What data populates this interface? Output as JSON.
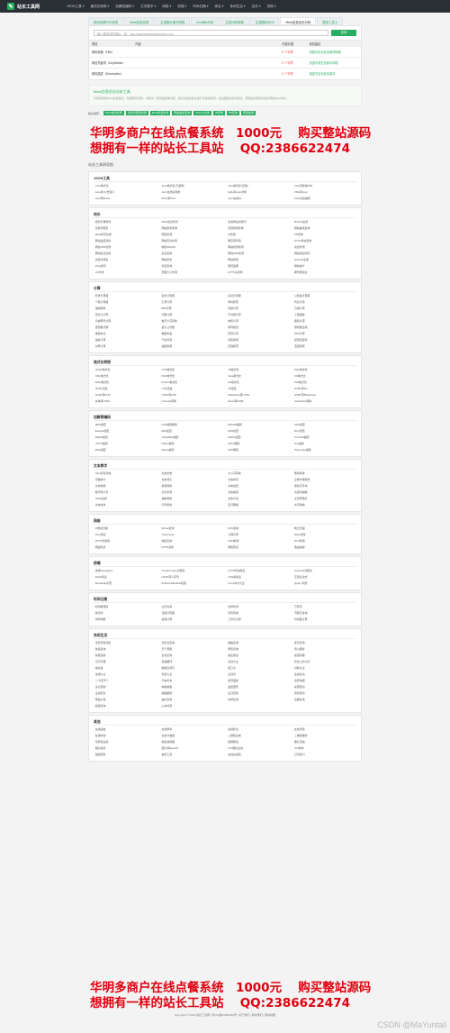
{
  "header": {
    "site_name": "站长工具网",
    "nav": [
      "JSON工具 ▾",
      "格式化转换 ▾",
      "加解密编码 ▾",
      "文本数字 ▾",
      "网络 ▾",
      "前端 ▾",
      "时间日期 ▾",
      "综合 ▾",
      "休闲生活 ▾",
      "站长 ▾",
      "其他 ▾"
    ]
  },
  "tabs": [
    "网页标题TDK检测",
    "Meta信息检测",
    "生成图片格式转换",
    "html转js代码",
    "生成代码转换",
    "生成随机MD5",
    "Meta信息优化分析",
    "更多工具 ▾"
  ],
  "query": {
    "placeholder": "输入要查询的网址，如：http://www.shimengzhanbao.com",
    "button": "查询"
  },
  "tdk_table": {
    "headers": [
      "项目",
      "内容",
      "内容长度",
      "优化建议"
    ],
    "rows": [
      {
        "item": "网页标题（Title）",
        "content": "",
        "length": "0 个字符",
        "advice": "标题中应包含关键词标题"
      },
      {
        "item": "网页关键词（KeyWords）",
        "content": "",
        "length": "0 个字符",
        "advice": "关键字需在页面中体现"
      },
      {
        "item": "网页描述（Description）",
        "content": "",
        "length": "0 个字符",
        "advice": "描述中应包含关键词"
      }
    ]
  },
  "meta_section": {
    "title": "Meta信息优化分析工具",
    "desc": "分析网页的Meta标签信息，包括网页标题、关键词、网页描述等内容，通过对这些信息进行长度的检测，给出相应的优化建议，帮助站长更好的进行网站SEO优化。"
  },
  "quick_tools": {
    "label": "相关推荐：",
    "items": [
      "Meta信息检测",
      "关键词密度检测",
      "Meta标签生成",
      "网站备案查询",
      "Robots生成",
      "IP查询",
      "PR查询",
      "死链检测"
    ]
  },
  "promo": {
    "line1": "华明多商户在线点餐系统　1000元　 购买整站源码",
    "line2": "想拥有一样的站长工具站　 QQ:2386622474"
  },
  "breadcrumb": "站长工具网导航",
  "categories": [
    {
      "name": "JSON工具",
      "items": [
        "Json格式化",
        "Json格式化(不兼容)",
        "Json格式化(压缩)",
        "Json转换成XML",
        "Json转义/去转义",
        "Json生成实体类",
        "SQL转Json对象",
        "XML转Json",
        "Json转Excel",
        "Excel转Json",
        "Json生成Go",
        "Json在线编辑"
      ]
    },
    {
      "name": "站长",
      "items": [
        "搜索引擎收录",
        "Meta信息检测",
        "生成网站关键词",
        "Robots生成",
        "关键词密度",
        "网站收录查询",
        "百度权重查询",
        "网站备案查询",
        "Meta标签生成",
        "死链检测",
        "IP查询",
        "PR查询",
        "网站速度测试",
        "网站安全检测",
        "网页源代码",
        "HTTP状态查询",
        "网站TDK检测",
        "域名WHOIS",
        "网站标题检测",
        "友链检测",
        "网站信息查询",
        "反链查询",
        "网站SEO检测",
        "网站响应时间",
        "关键词排名",
        "网站历史",
        "网站导航",
        "sitemap生成",
        "Ping检测",
        "外链查询",
        "网页截图",
        "网站统计",
        "UA分析",
        "页面大小检测",
        "HTTP头检测",
        "服务器信息"
      ]
    },
    {
      "name": "计算",
      "items": [
        "科学计算器",
        "贷款计算器",
        "房贷计算器",
        "公积金计算器",
        "个税计算器",
        "汇率计算",
        "单位换算",
        "利息计算",
        "进制转换",
        "BMI计算",
        "年龄计算",
        "日期计算",
        "百分比计算",
        "分数计算",
        "平方根计算",
        "三角函数",
        "亲戚称呼计算",
        "数字大写转换",
        "体积计算",
        "面积计算",
        "质因数分解",
        "最大公约数",
        "排列组合",
        "随机数生成",
        "等额本息",
        "等额本金",
        "存款计算",
        "GPA计算",
        "油耗计算",
        "汽车贷款",
        "时区换算",
        "经纬度距离",
        "功率计算",
        "速度换算",
        "压强换算",
        "温度换算"
      ]
    },
    {
      "name": "格式化转换",
      "items": [
        "HTML格式化",
        "CSS格式化",
        "JS格式化",
        "SQL格式化",
        "XML格式化",
        "PHP格式化",
        "Java格式化",
        "C#格式化",
        "Ruby格式化",
        "Python格式化",
        "Go格式化",
        "Perl格式化",
        "HTML压缩",
        "CSS压缩",
        "JS压缩",
        "HTML转JS",
        "HTML转PHP",
        "HTML转ASP",
        "Markdown转HTML",
        "HTML转Markdown",
        "文本转HTML",
        "Unicode转换",
        "Excel转HTML",
        "JavaScript转换"
      ]
    },
    {
      "name": "加解密编码",
      "items": [
        "MD5加密",
        "URL编码解码",
        "Base64编码",
        "SHA加密",
        "Escape加密",
        "AES加密",
        "DES加密",
        "RC4加密",
        "Rabbit加密",
        "TripleDES加密",
        "HMAC加密",
        "Unicode编码",
        "UTF-8编码",
        "Native编码",
        "ASCII编码",
        "Hex编码",
        "RSA加密",
        "Morse编码",
        "JWT解码",
        "Punycode编码"
      ]
    },
    {
      "name": "文本数字",
      "items": [
        "Html标签清除",
        "文本去重",
        "大小写转换",
        "繁简转换",
        "字数统计",
        "文本对比",
        "文本排序",
        "全角半角转换",
        "文本替换",
        "拼音转换",
        "文本加密",
        "随机字符串",
        "数字转大写",
        "文字反转",
        "文本提取",
        "关键词提取",
        "UUID生成",
        "进制转换",
        "文本分割",
        "文字转图片",
        "文本合并",
        "行号添加",
        "空行删除",
        "文字特效"
      ]
    },
    {
      "name": "网络",
      "items": [
        "IP地址归属",
        "Whois查询",
        "DNS查询",
        "端口扫描",
        "Ping测试",
        "Traceroute",
        "子网计算",
        "MAC查询",
        "HTTP状态码",
        "域名查询",
        "CDN检测",
        "IPv6检测",
        "网速测试",
        "HTTP请求",
        "网络延迟",
        "路由追踪"
      ]
    },
    {
      "name": "前端",
      "items": [
        "常用UserAgent",
        "Content-Type对照表",
        "HTTP状态码表",
        "Keycode对照表",
        "ASCII码表",
        "HTML转义字符",
        "CSS颜色表",
        "正则表达式",
        "Bootstrap手册",
        "Android Manifest权限",
        "Linux命令大全",
        "jQuery手册"
      ]
    },
    {
      "name": "时间日期",
      "items": [
        "时间戳转换",
        "北京时间",
        "世界时间",
        "万年历",
        "倒计时",
        "日期计算器",
        "农历转换",
        "节假日查询",
        "闰年判断",
        "星期计算",
        "工作日计算",
        "时间差计算"
      ]
    },
    {
      "name": "休闲生活",
      "items": [
        "手机号码归属",
        "身份证查询",
        "邮编查询",
        "区号查询",
        "快递查询",
        "天气预报",
        "黄历查询",
        "周公解梦",
        "星座运势",
        "生肖查询",
        "姓名测试",
        "成语词典",
        "汉字字典",
        "英语翻译",
        "菜谱大全",
        "历史上的今天",
        "歇后语",
        "脑筋急转弯",
        "绕口令",
        "对联大全",
        "谜语大全",
        "笑话大全",
        "古诗词",
        "名言名句",
        "二十四节气",
        "汽车标志",
        "世界国旗",
        "世界地图",
        "身高预测",
        "体重指数",
        "血型遗传",
        "星座配对",
        "生肖配对",
        "属相婚配",
        "生日密码",
        "周易算命",
        "黄金价格",
        "油价查询",
        "车牌查询",
        "违章查询",
        "航班查询",
        "火车时刻"
      ]
    },
    {
      "name": "其他",
      "items": [
        "在线画板",
        "在线钢琴",
        "在线秒表",
        "在线录音",
        "在线时钟",
        "在线计数器",
        "二维码生成",
        "二维码解析",
        "条形码生成",
        "颜色选择器",
        "屏幕取色",
        "图片压缩",
        "图片裁剪",
        "图片转Base64",
        "ICO图标生成",
        "GIF制作",
        "随机密码",
        "抽签工具",
        "在线白噪音",
        "打字练习"
      ]
    }
  ],
  "footer": "Copyright © 2024 站长工具网 | 京ICP备00000000号 | 关于我们 | 联系我们 | 网站地图",
  "watermark": "CSDN @MaYuntail"
}
